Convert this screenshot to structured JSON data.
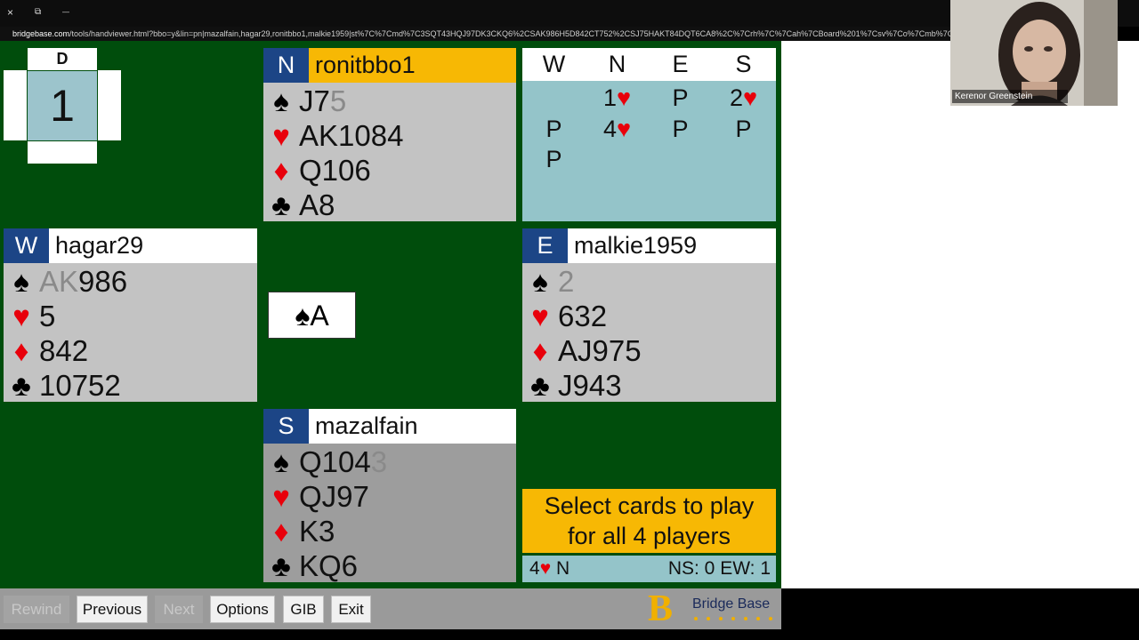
{
  "window": {
    "close_icon": "×",
    "restore_icon": "⧉",
    "minimize_icon": "—"
  },
  "url": {
    "domain": "bridgebase.com",
    "path": "/tools/handviewer.html?bbo=y&lin=pn|mazalfain,hagar29,ronitbbo1,malkie1959|st%7C%7Cmd%7C3SQT43HQJ97DK3CKQ6%2CSAK986H5D842CT752%2CSJ75HAKT84DQT6CA8%2C%7Crh%7C%7Cah%7CBoard%201%7Csv%7Co%7Cmb%7C"
  },
  "board": {
    "dealer_label": "D",
    "number": "1"
  },
  "hands": {
    "north": {
      "seat": "N",
      "player": "ronitbbo1",
      "spades_live": "J7",
      "spades_played": "5",
      "hearts": "AK1084",
      "diamonds": "Q106",
      "clubs": "A8"
    },
    "west": {
      "seat": "W",
      "player": "hagar29",
      "spades_played": "AK",
      "spades_live": "986",
      "hearts": "5",
      "diamonds": "842",
      "clubs": "10752"
    },
    "east": {
      "seat": "E",
      "player": "malkie1959",
      "spades_played": "2",
      "hearts": "632",
      "diamonds": "AJ975",
      "clubs": "J943"
    },
    "south": {
      "seat": "S",
      "player": "mazalfain",
      "spades_live": "Q104",
      "spades_played": "3",
      "hearts": "QJ97",
      "diamonds": "K3",
      "clubs": "KQ6"
    }
  },
  "suits": {
    "spade": "♠",
    "heart": "♥",
    "diamond": "♦",
    "club": "♣"
  },
  "auction": {
    "headers": [
      "W",
      "N",
      "E",
      "S"
    ],
    "row1": {
      "n_level": "1",
      "e": "P",
      "s_level": "2"
    },
    "row2": {
      "w": "P",
      "n_level": "4",
      "e": "P",
      "s": "P"
    },
    "row3": {
      "w": "P"
    }
  },
  "trick": {
    "card_rank": "A"
  },
  "banner": {
    "line1": "Select cards to play",
    "line2": "for all 4 players"
  },
  "status": {
    "contract_level": "4",
    "declarer": "N",
    "score": "NS: 0 EW: 1"
  },
  "toolbar": {
    "rewind": "Rewind",
    "previous": "Previous",
    "next": "Next",
    "options": "Options",
    "gib": "GIB",
    "exit": "Exit"
  },
  "logo": {
    "letter": "B",
    "text": "Bridge Base"
  },
  "video": {
    "participant": "Kerenor Greenstein"
  },
  "colors": {
    "felt": "#004d0c",
    "seat_blue": "#1c4586",
    "active_yellow": "#f7b804",
    "auction_teal": "#94c4c9",
    "heart_red": "#e8000b"
  }
}
